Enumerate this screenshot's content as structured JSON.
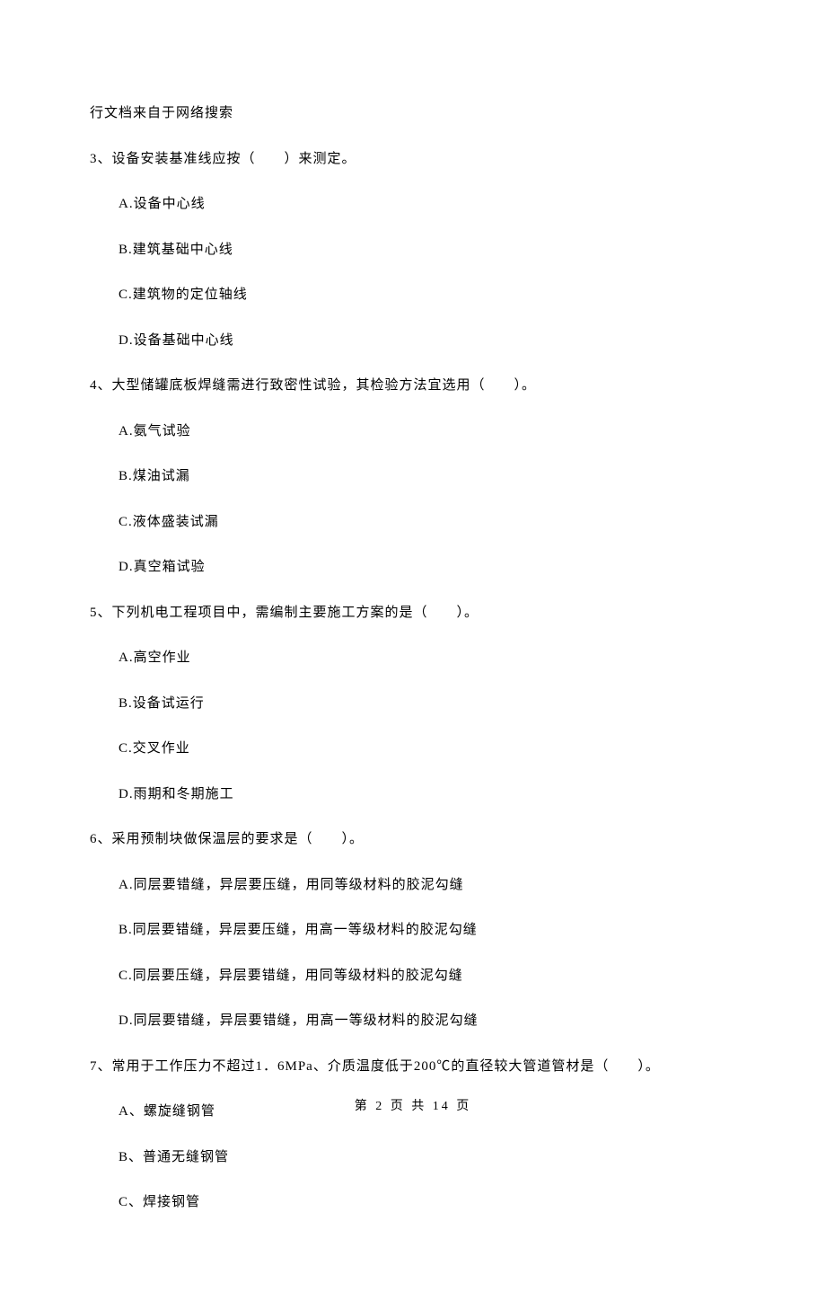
{
  "header_note": "行文档来自于网络搜索",
  "questions": [
    {
      "number": "3",
      "text": "3、设备安装基准线应按（　　）来测定。",
      "options": {
        "a": "A.设备中心线",
        "b": "B.建筑基础中心线",
        "c": "C.建筑物的定位轴线",
        "d": "D.设备基础中心线"
      }
    },
    {
      "number": "4",
      "text": "4、大型储罐底板焊缝需进行致密性试验，其检验方法宜选用（　　）。",
      "options": {
        "a": "A.氨气试验",
        "b": "B.煤油试漏",
        "c": "C.液体盛装试漏",
        "d": "D.真空箱试验"
      }
    },
    {
      "number": "5",
      "text": "5、下列机电工程项目中，需编制主要施工方案的是（　　）。",
      "options": {
        "a": "A.高空作业",
        "b": "B.设备试运行",
        "c": "C.交叉作业",
        "d": "D.雨期和冬期施工"
      }
    },
    {
      "number": "6",
      "text": "6、采用预制块做保温层的要求是（　　）。",
      "options": {
        "a": "A.同层要错缝，异层要压缝，用同等级材料的胶泥勾缝",
        "b": "B.同层要错缝，异层要压缝，用高一等级材料的胶泥勾缝",
        "c": "C.同层要压缝，异层要错缝，用同等级材料的胶泥勾缝",
        "d": "D.同层要错缝，异层要错缝，用高一等级材料的胶泥勾缝"
      }
    },
    {
      "number": "7",
      "text": "7、常用于工作压力不超过1．6MPa、介质温度低于200℃的直径较大管道管材是（　　）。",
      "options": {
        "a": "A、螺旋缝钢管",
        "b": "B、普通无缝钢管",
        "c": "C、焊接钢管"
      }
    }
  ],
  "footer": "第 2 页 共 14 页"
}
